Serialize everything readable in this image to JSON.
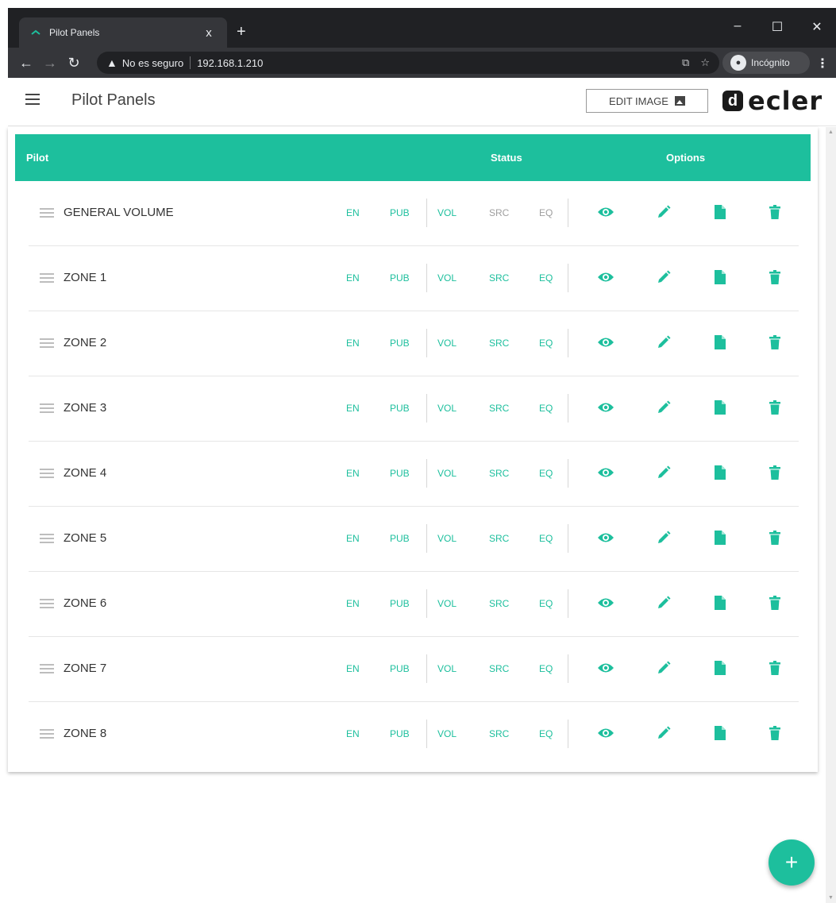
{
  "browser": {
    "tab_title": "Pilot Panels",
    "tab_close": "x",
    "new_tab": "+",
    "security_label": "No es seguro",
    "url": "192.168.1.210",
    "incognito_label": "Incógnito",
    "window_controls": [
      "–",
      "☐",
      "✕"
    ]
  },
  "header": {
    "title": "Pilot Panels",
    "edit_image_label": "EDIT IMAGE",
    "logo_text": "ecler"
  },
  "table": {
    "columns": {
      "pilot": "Pilot",
      "status": "Status",
      "options": "Options"
    },
    "status_labels": [
      "EN",
      "PUB",
      "VOL",
      "SRC",
      "EQ"
    ],
    "rows": [
      {
        "name": "GENERAL VOLUME",
        "status_active": [
          true,
          true,
          true,
          false,
          false
        ]
      },
      {
        "name": "ZONE 1",
        "status_active": [
          true,
          true,
          true,
          true,
          true
        ]
      },
      {
        "name": "ZONE 2",
        "status_active": [
          true,
          true,
          true,
          true,
          true
        ]
      },
      {
        "name": "ZONE 3",
        "status_active": [
          true,
          true,
          true,
          true,
          true
        ]
      },
      {
        "name": "ZONE 4",
        "status_active": [
          true,
          true,
          true,
          true,
          true
        ]
      },
      {
        "name": "ZONE 5",
        "status_active": [
          true,
          true,
          true,
          true,
          true
        ]
      },
      {
        "name": "ZONE 6",
        "status_active": [
          true,
          true,
          true,
          true,
          true
        ]
      },
      {
        "name": "ZONE 7",
        "status_active": [
          true,
          true,
          true,
          true,
          true
        ]
      },
      {
        "name": "ZONE 8",
        "status_active": [
          true,
          true,
          true,
          true,
          true
        ]
      }
    ],
    "option_icons": [
      "eye-icon",
      "pencil-icon",
      "file-icon",
      "trash-icon"
    ]
  },
  "fab": {
    "label": "+"
  },
  "colors": {
    "accent": "#1dbf9d",
    "inactive": "#9e9e9e",
    "chrome_dark": "#202124",
    "chrome_mid": "#35363a"
  }
}
